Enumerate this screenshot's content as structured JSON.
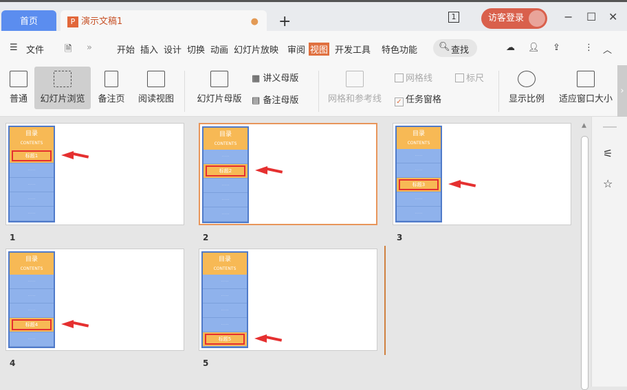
{
  "tabs": {
    "home": "首页",
    "doc": "演示文稿1",
    "doc_icon": "P",
    "new_tab": "+"
  },
  "titlebar": {
    "page_indicator": "1",
    "login": "访客登录",
    "minimize": "−",
    "maximize": "☐",
    "close": "✕"
  },
  "menu": {
    "file": "文件",
    "items": [
      "开始",
      "插入",
      "设计",
      "切换",
      "动画",
      "幻灯片放映",
      "审阅",
      "视图",
      "开发工具",
      "特色功能"
    ],
    "active": "视图",
    "search": "查找"
  },
  "ribbon": {
    "normal": "普通",
    "slide_sorter": "幻灯片浏览",
    "notes_page": "备注页",
    "reading_view": "阅读视图",
    "slide_master": "幻灯片母版",
    "handout_master": "讲义母版",
    "notes_master": "备注母版",
    "grid_guides": "网格和参考线",
    "gridlines": "网格线",
    "ruler": "标尺",
    "task_pane": "任务窗格",
    "zoom": "显示比例",
    "fit_window": "适应窗口大小"
  },
  "slides": [
    {
      "number": "1",
      "title": "目录",
      "subtitle": "CONTENTS",
      "highlight_row": 1,
      "highlight_label": "标题1",
      "selected": false
    },
    {
      "number": "2",
      "title": "目录",
      "subtitle": "CONTENTS",
      "highlight_row": 2,
      "highlight_label": "标题2",
      "selected": true
    },
    {
      "number": "3",
      "title": "目录",
      "subtitle": "CONTENTS",
      "highlight_row": 3,
      "highlight_label": "标题3",
      "selected": false
    },
    {
      "number": "4",
      "title": "目录",
      "subtitle": "CONTENTS",
      "highlight_row": 4,
      "highlight_label": "标题4",
      "selected": false
    },
    {
      "number": "5",
      "title": "目录",
      "subtitle": "CONTENTS",
      "highlight_row": 5,
      "highlight_label": "标题5",
      "selected": false
    }
  ]
}
